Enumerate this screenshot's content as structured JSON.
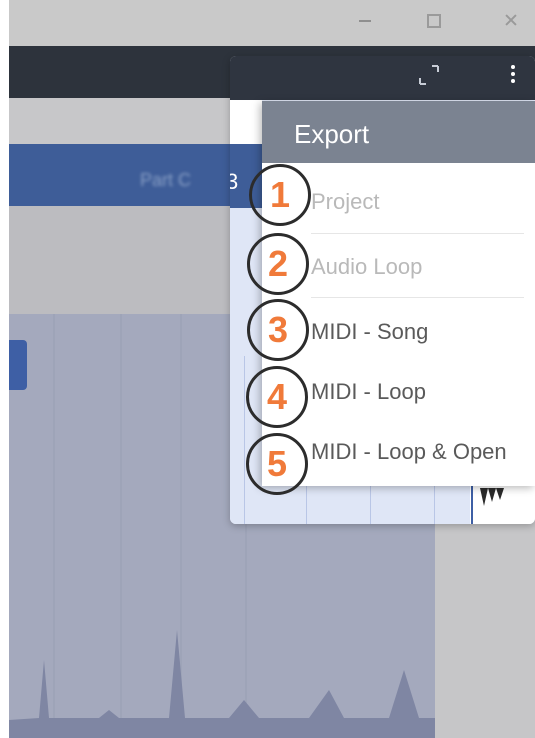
{
  "window_controls": {
    "minimize_icon": "minimize-icon",
    "maximize_icon": "maximize-icon",
    "close_icon": "close-icon"
  },
  "background": {
    "track_label": "Part C",
    "panel_track_label": "3"
  },
  "export_menu": {
    "title": "Export",
    "items": [
      {
        "label": "Project",
        "enabled": false
      },
      {
        "label": "Audio Loop",
        "enabled": false
      },
      {
        "label": "MIDI - Song",
        "enabled": true
      },
      {
        "label": "MIDI - Loop",
        "enabled": true
      },
      {
        "label": "MIDI - Loop & Open",
        "enabled": true
      }
    ]
  },
  "callouts": [
    {
      "number": "1"
    },
    {
      "number": "2"
    },
    {
      "number": "3"
    },
    {
      "number": "4"
    },
    {
      "number": "5"
    }
  ],
  "colors": {
    "callout_number": "#f07a3a",
    "menu_header": "#7b8391",
    "toolbar": "#2d333c"
  }
}
